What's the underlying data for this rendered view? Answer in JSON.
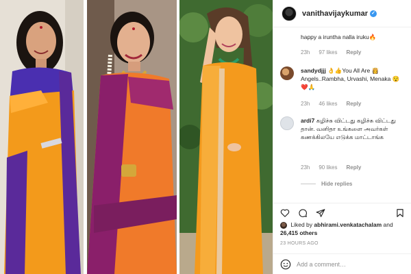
{
  "post": {
    "username": "vanithavijaykumar",
    "verified": true,
    "verified_glyph": "✓",
    "timestamp": "23 HOURS AGO",
    "add_comment_placeholder": "Add a comment…"
  },
  "comments": [
    {
      "username": "",
      "text": "happy a iruntha nalla iruku🔥",
      "age": "23h",
      "likes": "97 likes",
      "reply": "Reply"
    },
    {
      "username": "sandydjjj",
      "text": "👌👍You All Are 👸 Angels..Rambha, Urvashi, Menaka 😯❤️🙏",
      "age": "23h",
      "likes": "46 likes",
      "reply": "Reply"
    },
    {
      "username": "ardi7",
      "text": "கழிச்சு விட்டது கழிச்சு விட்டது தான். வனிதா உங்களை அவர்கள் கணக்கிலயே எடுக்க மாட்டாங்க",
      "age": "23h",
      "likes": "90 likes",
      "reply": "Reply"
    }
  ],
  "hide_replies": "Hide replies",
  "likes": {
    "prefix": "Liked by",
    "by_user": "abhirami.venkatachalam",
    "joiner": "and",
    "others": "26,415 others"
  },
  "icons": {
    "like": "heart-icon",
    "comment": "comment-icon",
    "share": "share-icon",
    "save": "bookmark-icon",
    "emoji": "smile-icon"
  },
  "colors": {
    "saree_orange": "#f39a1b",
    "saree_purple": "#4b1f8f",
    "verified_blue": "#3897f0",
    "meta_gray": "#8e8e8e"
  }
}
